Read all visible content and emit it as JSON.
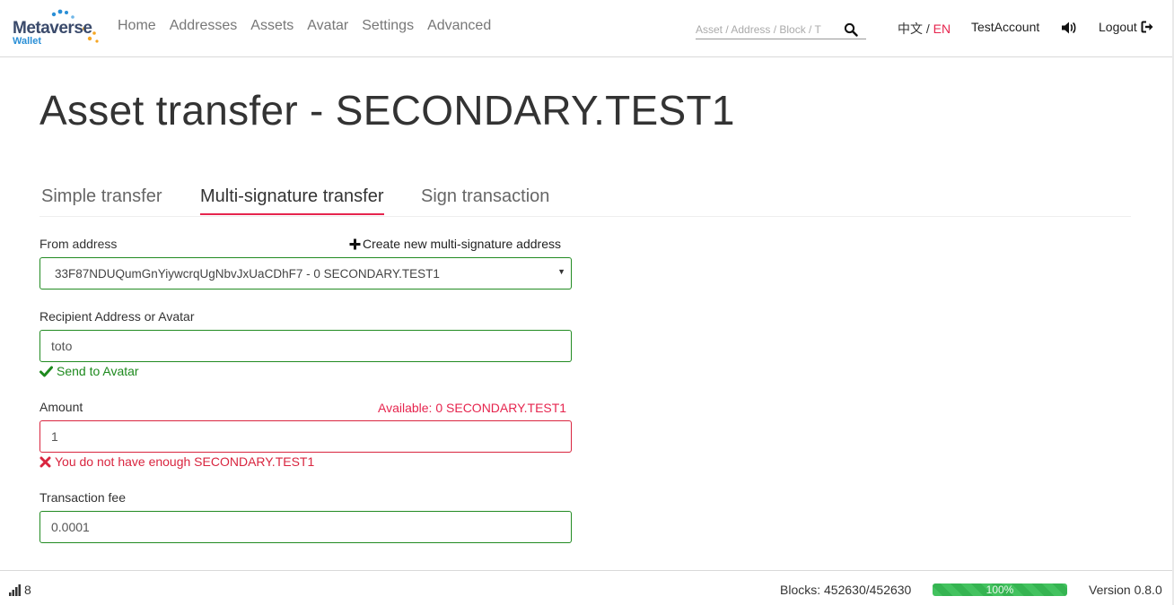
{
  "brand": {
    "name": "Metaverse",
    "sub": "Wallet"
  },
  "nav": {
    "links": [
      "Home",
      "Addresses",
      "Assets",
      "Avatar",
      "Settings",
      "Advanced"
    ],
    "search_placeholder": "Asset / Address / Block / T",
    "lang_zh": "中文",
    "lang_sep": " / ",
    "lang_en": "EN",
    "account": "TestAccount",
    "logout": "Logout"
  },
  "page": {
    "title": "Asset transfer - SECONDARY.TEST1"
  },
  "tabs": [
    {
      "label": "Simple transfer",
      "active": false
    },
    {
      "label": "Multi-signature transfer",
      "active": true
    },
    {
      "label": "Sign transaction",
      "active": false
    }
  ],
  "form": {
    "from_label": "From address",
    "create_link": "Create new multi-signature address",
    "from_value": "33F87NDUQumGnYiywcrqUgNbvJxUaCDhF7 - 0 SECONDARY.TEST1",
    "recipient_label": "Recipient Address or Avatar",
    "recipient_value": "toto",
    "recipient_hint": "Send to Avatar",
    "amount_label": "Amount",
    "available": "Available: 0 SECONDARY.TEST1",
    "amount_value": "1",
    "amount_error": "You do not have enough SECONDARY.TEST1",
    "fee_label": "Transaction fee",
    "fee_value": "0.0001"
  },
  "footer": {
    "peers": "8",
    "blocks": "Blocks: 452630/452630",
    "sync_progress": 1.0,
    "sync_label": "100%",
    "version": "Version 0.8.0"
  },
  "colors": {
    "accent": "#e6254e",
    "valid": "#228b22",
    "error": "#d9253f",
    "progress": "#43c25f"
  }
}
